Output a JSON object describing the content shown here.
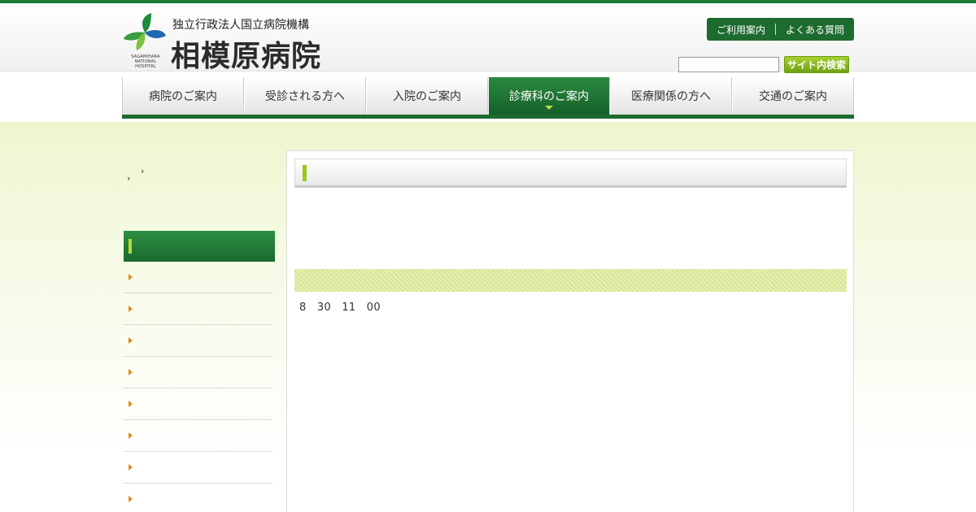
{
  "header": {
    "org_name": "独立行政法人国立病院機構",
    "hospital_name": "相模原病院",
    "logo_en": "SAGAMIHARA NATIONAL HOSPITAL",
    "util_links": [
      "ご利用案内",
      "よくある質問"
    ],
    "search_placeholder": "",
    "search_button": "サイト内検索"
  },
  "gnav": {
    "items": [
      "病院のご案内",
      "受診される方へ",
      "入院のご案内",
      "診療科のご案内",
      "医療関係の方へ",
      "交通のご案内"
    ],
    "active_index": 3
  },
  "breadcrumb": [
    "›",
    "›"
  ],
  "sidebar": {
    "heading": "",
    "items": [
      "",
      "",
      "",
      "",
      "",
      "",
      "",
      ""
    ]
  },
  "main": {
    "page_heading": "",
    "title": "",
    "anchor_links": [
      "",
      "",
      "",
      "",
      ""
    ],
    "section_heading": "",
    "paragraphs": [
      [
        "8　30　11　00"
      ],
      [
        ""
      ]
    ]
  },
  "colors": {
    "brand_green": "#1e6b2f",
    "accent_lime": "#9bc81e",
    "link_teal": "#1f7a8c",
    "sidebar_arrow": "#e28a15"
  }
}
